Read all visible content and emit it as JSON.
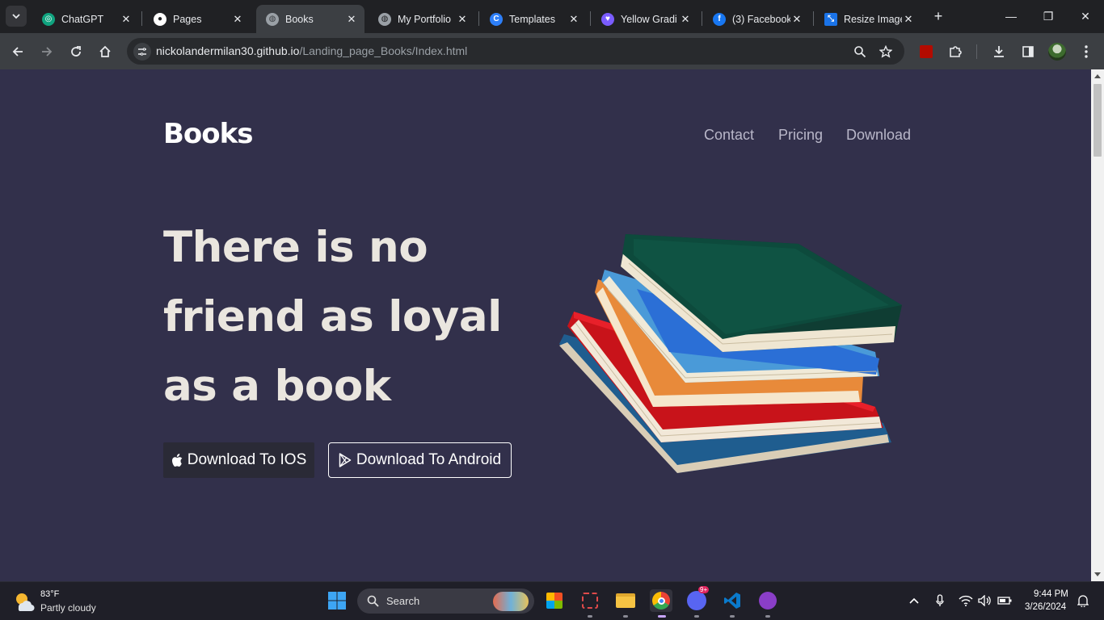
{
  "browser": {
    "tabs": [
      {
        "label": "ChatGPT",
        "icon": "chatgpt-icon",
        "active": false
      },
      {
        "label": "Pages",
        "icon": "github-icon",
        "active": false
      },
      {
        "label": "Books",
        "icon": "globe-icon",
        "active": true
      },
      {
        "label": "My Portfolio",
        "icon": "globe-icon",
        "active": false
      },
      {
        "label": "Templates",
        "icon": "canva-icon",
        "active": false
      },
      {
        "label": "Yellow Gradi",
        "icon": "heart-icon",
        "active": false
      },
      {
        "label": "(3) Facebook",
        "icon": "facebook-icon",
        "active": false
      },
      {
        "label": "Resize Image",
        "icon": "resize-icon",
        "active": false
      }
    ],
    "url": {
      "host": "nickolandermilan30.github.io",
      "path": "/Landing_page_Books/Index.html"
    }
  },
  "site": {
    "brand": "Books",
    "nav": [
      "Contact",
      "Pricing",
      "Download"
    ],
    "hero_lines": [
      "There is no",
      "friend as loyal",
      "as a book"
    ],
    "btn_ios": "Download To IOS",
    "btn_android": "Download To Android",
    "colors": {
      "background": "#32304b",
      "hero_text": "#eae6df",
      "nav_text": "#b9b7c9"
    }
  },
  "taskbar": {
    "weather_temp": "83°F",
    "weather_desc": "Partly cloudy",
    "search_label": "Search",
    "discord_badge": "9+",
    "time": "9:44 PM",
    "date": "3/26/2024"
  }
}
